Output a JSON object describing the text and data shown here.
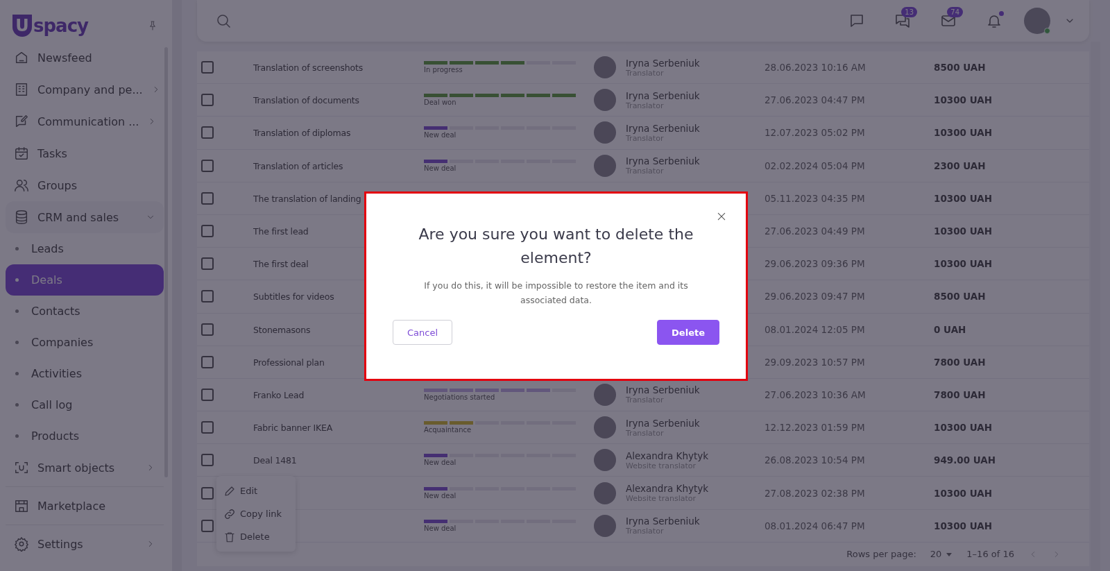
{
  "sidebar": {
    "logo": {
      "mark": "U",
      "text": "spacy"
    },
    "sections": [
      {
        "items": [
          {
            "label": "Newsfeed",
            "selected": false
          },
          {
            "label": "Company and pe...",
            "selected": false,
            "expanded": false
          },
          {
            "label": "Communication ...",
            "selected": false,
            "expanded": false
          },
          {
            "label": "Tasks",
            "selected": false
          },
          {
            "label": "Groups",
            "selected": false
          },
          {
            "label": "CRM and sales",
            "selected": false,
            "expanded": true,
            "children": [
              {
                "label": "Leads",
                "selected": false
              },
              {
                "label": "Deals",
                "selected": true
              },
              {
                "label": "Contacts",
                "selected": false
              },
              {
                "label": "Companies",
                "selected": false
              },
              {
                "label": "Activities",
                "selected": false
              },
              {
                "label": "Call log",
                "selected": false
              },
              {
                "label": "Products",
                "selected": false
              }
            ]
          },
          {
            "label": "Smart objects",
            "selected": false,
            "expanded": false
          }
        ]
      },
      {
        "items": [
          {
            "label": "Marketplace",
            "selected": false
          }
        ]
      },
      {
        "items": [
          {
            "label": "Settings",
            "selected": false,
            "expanded": false
          }
        ]
      }
    ]
  },
  "header": {
    "icons": [
      {
        "kind": "chat"
      },
      {
        "kind": "chats",
        "badge": "13"
      },
      {
        "kind": "mail",
        "badge": "74"
      },
      {
        "kind": "bell",
        "dot": true
      }
    ],
    "user": {
      "online": true
    }
  },
  "table": {
    "rows": [
      {
        "checked": false,
        "name": "Translation of screenshots",
        "stage": {
          "kind": "progress",
          "label": "In progress",
          "level": 0.667
        },
        "person": {
          "name": "Iryna Serbeniuk",
          "role": "Translator"
        },
        "date": "28.06.2023 10:16 AM",
        "amount": "8500 UAH"
      },
      {
        "checked": false,
        "name": "Translation of documents",
        "stage": {
          "kind": "won",
          "label": "Deal won",
          "level": 1
        },
        "person": {
          "name": "Iryna Serbeniuk",
          "role": "Translator"
        },
        "date": "27.06.2023 04:47 PM",
        "amount": "10300 UAH"
      },
      {
        "checked": false,
        "name": "Translation of diplomas",
        "stage": {
          "kind": "new",
          "label": "New deal",
          "level": 0.167
        },
        "person": {
          "name": "Iryna Serbeniuk",
          "role": "Translator"
        },
        "date": "12.07.2023 05:02 PM",
        "amount": "10300 UAH"
      },
      {
        "checked": false,
        "name": "Translation of articles",
        "stage": {
          "kind": "new",
          "label": "New deal",
          "level": 0.167
        },
        "person": {
          "name": "Iryna Serbeniuk",
          "role": "Translator"
        },
        "date": "02.02.2024 05:04 PM",
        "amount": "2300 UAH"
      },
      {
        "checked": false,
        "name": "The translation of landing",
        "date": "05.11.2023 04:35 PM",
        "amount": "10300 UAH"
      },
      {
        "checked": false,
        "name": "The first lead",
        "date": "27.06.2023 04:49 PM",
        "amount": "10300 UAH"
      },
      {
        "checked": false,
        "name": "The first deal",
        "date": "29.06.2023 09:36 PM",
        "amount": "10300 UAH"
      },
      {
        "checked": false,
        "name": "Subtitles for videos",
        "date": "29.06.2023 09:47 PM",
        "amount": "8500 UAH"
      },
      {
        "checked": false,
        "name": "Stonemasons",
        "date": "08.01.2024 12:05 PM",
        "amount": "0 UAH"
      },
      {
        "checked": false,
        "name": "Professional plan",
        "date": "29.09.2023 10:57 PM",
        "amount": "7800 UAH"
      },
      {
        "checked": false,
        "name": "Franko Lead",
        "stage": {
          "kind": "negotiation",
          "label": "Negotiations started",
          "level": 0.833
        },
        "person": {
          "name": "Iryna Serbeniuk",
          "role": "Translator"
        },
        "date": "27.06.2023 10:36 AM",
        "amount": "7800 UAH"
      },
      {
        "checked": false,
        "name": "Fabric banner IKEA",
        "stage": {
          "kind": "acquaintance",
          "label": "Acquaintance",
          "level": 0.333
        },
        "person": {
          "name": "Iryna Serbeniuk",
          "role": "Translator"
        },
        "date": "12.12.2023 01:59 PM",
        "amount": "10300 UAH"
      },
      {
        "checked": false,
        "name": "Deal 1481",
        "stage": {
          "kind": "new",
          "label": "New deal",
          "level": 0.167
        },
        "person": {
          "name": "Alexandra Khytyk",
          "role": "Website translator"
        },
        "date": "26.08.2023 10:54 PM",
        "amount": "949.00 UAH"
      },
      {
        "checked": false,
        "stage": {
          "kind": "new",
          "label": "New deal",
          "level": 0.167
        },
        "person": {
          "name": "Alexandra Khytyk",
          "role": "Website translator"
        },
        "date": "27.08.2023 02:38 PM",
        "amount": "10300 UAH"
      },
      {
        "checked": false,
        "stage": {
          "kind": "new",
          "label": "New deal",
          "level": 0.167
        },
        "person": {
          "name": "Iryna Serbeniuk",
          "role": "Translator"
        },
        "date": "08.01.2024 06:47 PM",
        "amount": "10300 UAH"
      }
    ],
    "pagination": {
      "rows_label": "Rows per page:",
      "rows_value": "20",
      "range": "1–16 of 16"
    }
  },
  "context_menu": {
    "items": [
      {
        "kind": "edit",
        "label": "Edit"
      },
      {
        "kind": "link",
        "label": "Copy link"
      },
      {
        "kind": "delete",
        "label": "Delete"
      }
    ]
  },
  "dialog": {
    "title": "Are you sure you want to delete the element?",
    "message": "If you do this, it will be impossible to restore the item and its associated data.",
    "buttons": [
      {
        "kind": "secondary",
        "label": "Cancel"
      },
      {
        "kind": "primary",
        "label": "Delete"
      }
    ]
  }
}
